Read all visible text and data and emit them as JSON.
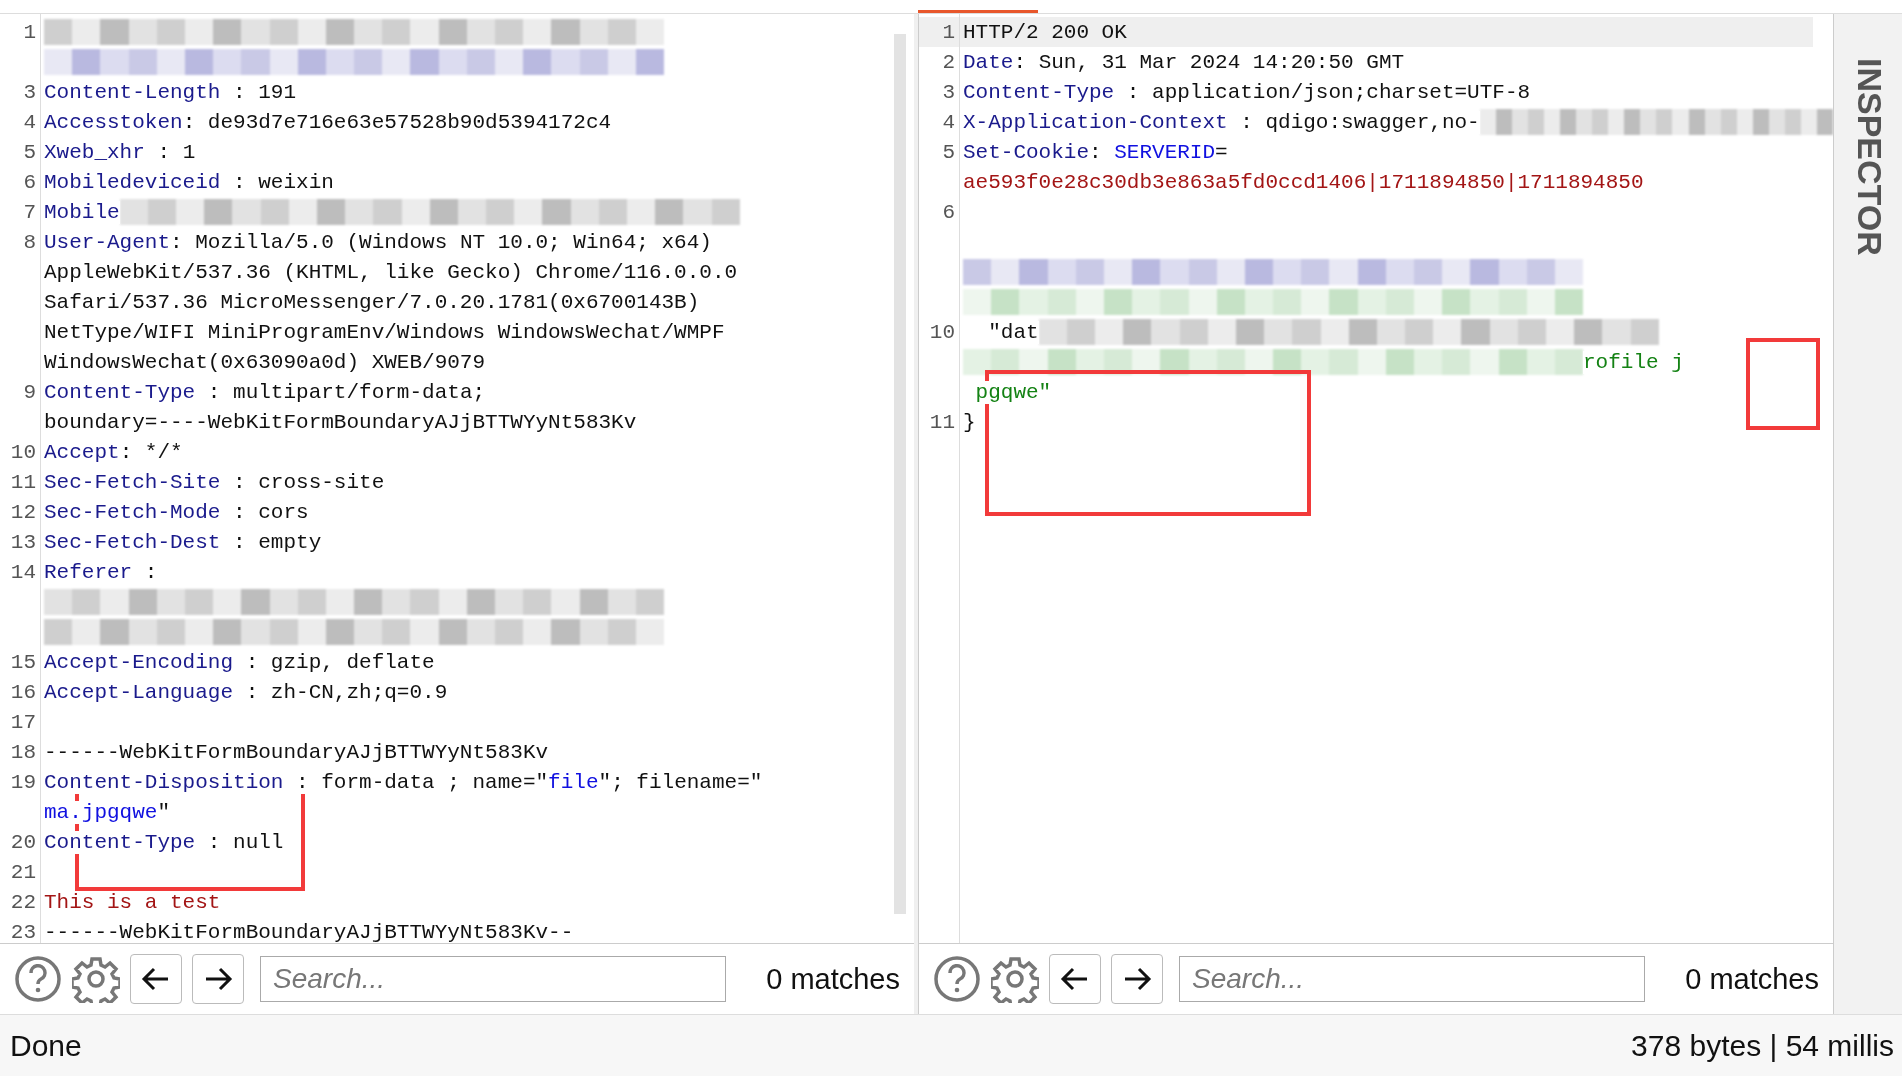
{
  "panes": [
    {
      "rows": [
        {
          "num": "1",
          "segments": [
            {
              "kind": "blur-grey"
            }
          ]
        },
        {
          "segments": [
            {
              "kind": "blur-violet"
            }
          ]
        },
        {
          "num": "3",
          "segments": [
            {
              "kind": "key",
              "text": "Content-Length"
            },
            {
              "kind": "plain",
              "text": " : 191"
            }
          ]
        },
        {
          "num": "4",
          "segments": [
            {
              "kind": "key",
              "text": "Accesstoken"
            },
            {
              "kind": "plain",
              "text": ": de93d7e716e63e57528b90d5394172c4"
            }
          ]
        },
        {
          "num": "5",
          "segments": [
            {
              "kind": "key",
              "text": "Xweb_xhr"
            },
            {
              "kind": "plain",
              "text": " : 1"
            }
          ]
        },
        {
          "num": "6",
          "segments": [
            {
              "kind": "key",
              "text": "Mobiledeviceid"
            },
            {
              "kind": "plain",
              "text": " : weixin"
            }
          ]
        },
        {
          "num": "7",
          "segments": [
            {
              "kind": "key",
              "text": "Mobile"
            },
            {
              "kind": "blur-grey"
            }
          ]
        },
        {
          "num": "8",
          "segments": [
            {
              "kind": "key",
              "text": "User-Agent"
            },
            {
              "kind": "plain",
              "text": ": Mozilla/5.0 (Windows NT 10.0; Win64; x64)"
            }
          ]
        },
        {
          "segments": [
            {
              "kind": "plain",
              "text": "AppleWebKit/537.36 (KHTML, like Gecko) Chrome/116.0.0.0"
            }
          ]
        },
        {
          "segments": [
            {
              "kind": "plain",
              "text": "Safari/537.36 MicroMessenger/7.0.20.1781(0x6700143B)"
            }
          ]
        },
        {
          "segments": [
            {
              "kind": "plain",
              "text": "NetType/WIFI MiniProgramEnv/Windows WindowsWechat/WMPF"
            }
          ]
        },
        {
          "segments": [
            {
              "kind": "plain",
              "text": "WindowsWechat(0x63090a0d) XWEB/9079"
            }
          ]
        },
        {
          "num": "9",
          "segments": [
            {
              "kind": "key",
              "text": "Content-Type"
            },
            {
              "kind": "plain",
              "text": " : multipart/form-data;"
            }
          ]
        },
        {
          "segments": [
            {
              "kind": "plain",
              "text": "boundary=----WebKitFormBoundaryAJjBTTWYyNt583Kv"
            }
          ]
        },
        {
          "num": "10",
          "segments": [
            {
              "kind": "key",
              "text": "Accept"
            },
            {
              "kind": "plain",
              "text": ": */*"
            }
          ]
        },
        {
          "num": "11",
          "segments": [
            {
              "kind": "key",
              "text": "Sec-Fetch-Site"
            },
            {
              "kind": "plain",
              "text": " : cross-site"
            }
          ]
        },
        {
          "num": "12",
          "segments": [
            {
              "kind": "key",
              "text": "Sec-Fetch-Mode"
            },
            {
              "kind": "plain",
              "text": " : cors"
            }
          ]
        },
        {
          "num": "13",
          "segments": [
            {
              "kind": "key",
              "text": "Sec-Fetch-Dest"
            },
            {
              "kind": "plain",
              "text": " : empty"
            }
          ]
        },
        {
          "num": "14",
          "segments": [
            {
              "kind": "key",
              "text": "Referer"
            },
            {
              "kind": "plain",
              "text": " :"
            }
          ]
        },
        {
          "segments": [
            {
              "kind": "blur-grey"
            }
          ]
        },
        {
          "segments": [
            {
              "kind": "blur-grey"
            }
          ]
        },
        {
          "num": "15",
          "segments": [
            {
              "kind": "key",
              "text": "Accept-Encoding"
            },
            {
              "kind": "plain",
              "text": " : gzip, deflate"
            }
          ]
        },
        {
          "num": "16",
          "segments": [
            {
              "kind": "key",
              "text": "Accept-Language"
            },
            {
              "kind": "plain",
              "text": " : zh-CN,zh;q=0.9"
            }
          ]
        },
        {
          "num": "17",
          "segments": []
        },
        {
          "num": "18",
          "segments": [
            {
              "kind": "plain",
              "text": "------WebKitFormBoundaryAJjBTTWYyNt583Kv"
            }
          ]
        },
        {
          "num": "19",
          "segments": [
            {
              "kind": "key",
              "text": "Content-Disposition"
            },
            {
              "kind": "plain",
              "text": " : form-data ; name=\""
            },
            {
              "kind": "string",
              "text": "file"
            },
            {
              "kind": "plain",
              "text": "\"; filename=\""
            }
          ]
        },
        {
          "segments": [
            {
              "kind": "string",
              "text": "ma.jpgqwe"
            },
            {
              "kind": "plain",
              "text": "\""
            }
          ]
        },
        {
          "num": "20",
          "segments": [
            {
              "kind": "key",
              "text": "Content-Type"
            },
            {
              "kind": "plain",
              "text": " : null"
            }
          ]
        },
        {
          "num": "21",
          "segments": []
        },
        {
          "num": "22",
          "segments": [
            {
              "kind": "body",
              "text": "This is a test"
            }
          ]
        },
        {
          "num": "23",
          "segments": [
            {
              "kind": "plain",
              "text": "------WebKitFormBoundaryAJjBTTWYyNt583Kv--"
            }
          ]
        }
      ],
      "search": {
        "placeholder": "Search...",
        "matches": "0 matches"
      }
    },
    {
      "rows": [
        {
          "num": "1",
          "current": true,
          "segments": [
            {
              "kind": "plain",
              "text": "HTTP/2 200 OK"
            }
          ]
        },
        {
          "num": "2",
          "segments": [
            {
              "kind": "key",
              "text": "Date"
            },
            {
              "kind": "plain",
              "text": ": Sun, 31 Mar 2024 14:20:50 GMT"
            }
          ]
        },
        {
          "num": "3",
          "segments": [
            {
              "kind": "key",
              "text": "Content-Type"
            },
            {
              "kind": "plain",
              "text": " : application/json;charset=UTF-8"
            }
          ]
        },
        {
          "num": "4",
          "segments": [
            {
              "kind": "key",
              "text": "X-Application-Context"
            },
            {
              "kind": "plain",
              "text": " : qdigo:swagger,no-"
            },
            {
              "kind": "blur-grey"
            }
          ]
        },
        {
          "num": "5",
          "segments": [
            {
              "kind": "key",
              "text": "Set-Cookie"
            },
            {
              "kind": "plain",
              "text": ": "
            },
            {
              "kind": "string",
              "text": "SERVERID"
            },
            {
              "kind": "plain",
              "text": "="
            }
          ]
        },
        {
          "segments": [
            {
              "kind": "body",
              "text": "ae593f0e28c30db3e863a5fd0ccd1406|1711894850|1711894850"
            }
          ]
        },
        {
          "num": "6",
          "segments": []
        },
        {
          "segments": []
        },
        {
          "segments": [
            {
              "kind": "blur-violet"
            }
          ]
        },
        {
          "segments": [
            {
              "kind": "blur-green"
            }
          ]
        },
        {
          "num": "10",
          "segments": [
            {
              "kind": "plain",
              "text": "  \"dat"
            },
            {
              "kind": "blur-grey"
            }
          ]
        },
        {
          "segments": [
            {
              "kind": "blur-green"
            },
            {
              "kind": "json",
              "text": "rofile j"
            }
          ]
        },
        {
          "segments": [
            {
              "kind": "json",
              "text": " pgqwe\""
            }
          ]
        },
        {
          "num": "11",
          "segments": [
            {
              "kind": "plain",
              "text": "}"
            }
          ]
        }
      ],
      "search": {
        "placeholder": "Search...",
        "matches": "0 matches"
      }
    }
  ],
  "inspector": {
    "title": "INSPECTOR"
  },
  "status_bar": {
    "left": "Done",
    "right": "378 bytes | 54 millis"
  }
}
